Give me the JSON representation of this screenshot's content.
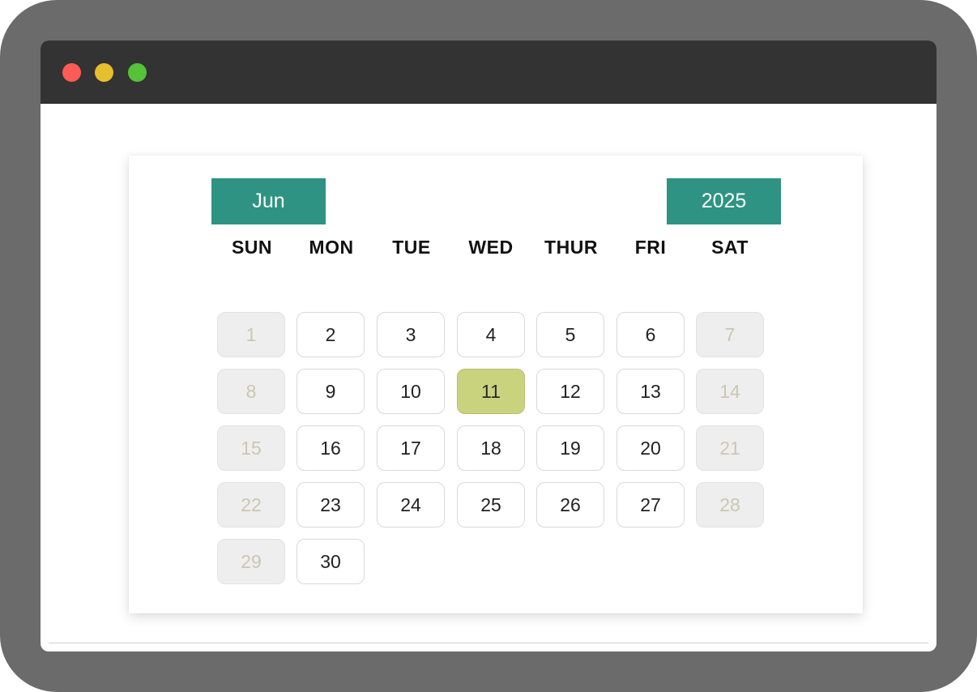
{
  "window": {
    "controls": [
      "close",
      "minimize",
      "maximize"
    ]
  },
  "calendar": {
    "month_label": "Jun",
    "year_label": "2025",
    "weekdays": [
      "SUN",
      "MON",
      "TUE",
      "WED",
      "THUR",
      "FRI",
      "SAT"
    ],
    "days": [
      "1",
      "2",
      "3",
      "4",
      "5",
      "6",
      "7",
      "8",
      "9",
      "10",
      "11",
      "12",
      "13",
      "14",
      "15",
      "16",
      "17",
      "18",
      "19",
      "20",
      "21",
      "22",
      "23",
      "24",
      "25",
      "26",
      "27",
      "28",
      "29",
      "30"
    ],
    "first_weekday_index": 0,
    "selected_day": "11",
    "disabled_weekdays": [
      "SUN",
      "SAT"
    ]
  },
  "colors": {
    "accent": "#2e9383",
    "selected": "#c9d37e",
    "disabled_bg": "#eeeeee",
    "disabled_text": "#c8c8b2",
    "titlebar": "#333333",
    "close_dot": "#fd5b56",
    "minimize_dot": "#e6bf2e",
    "maximize_dot": "#55c23a"
  }
}
